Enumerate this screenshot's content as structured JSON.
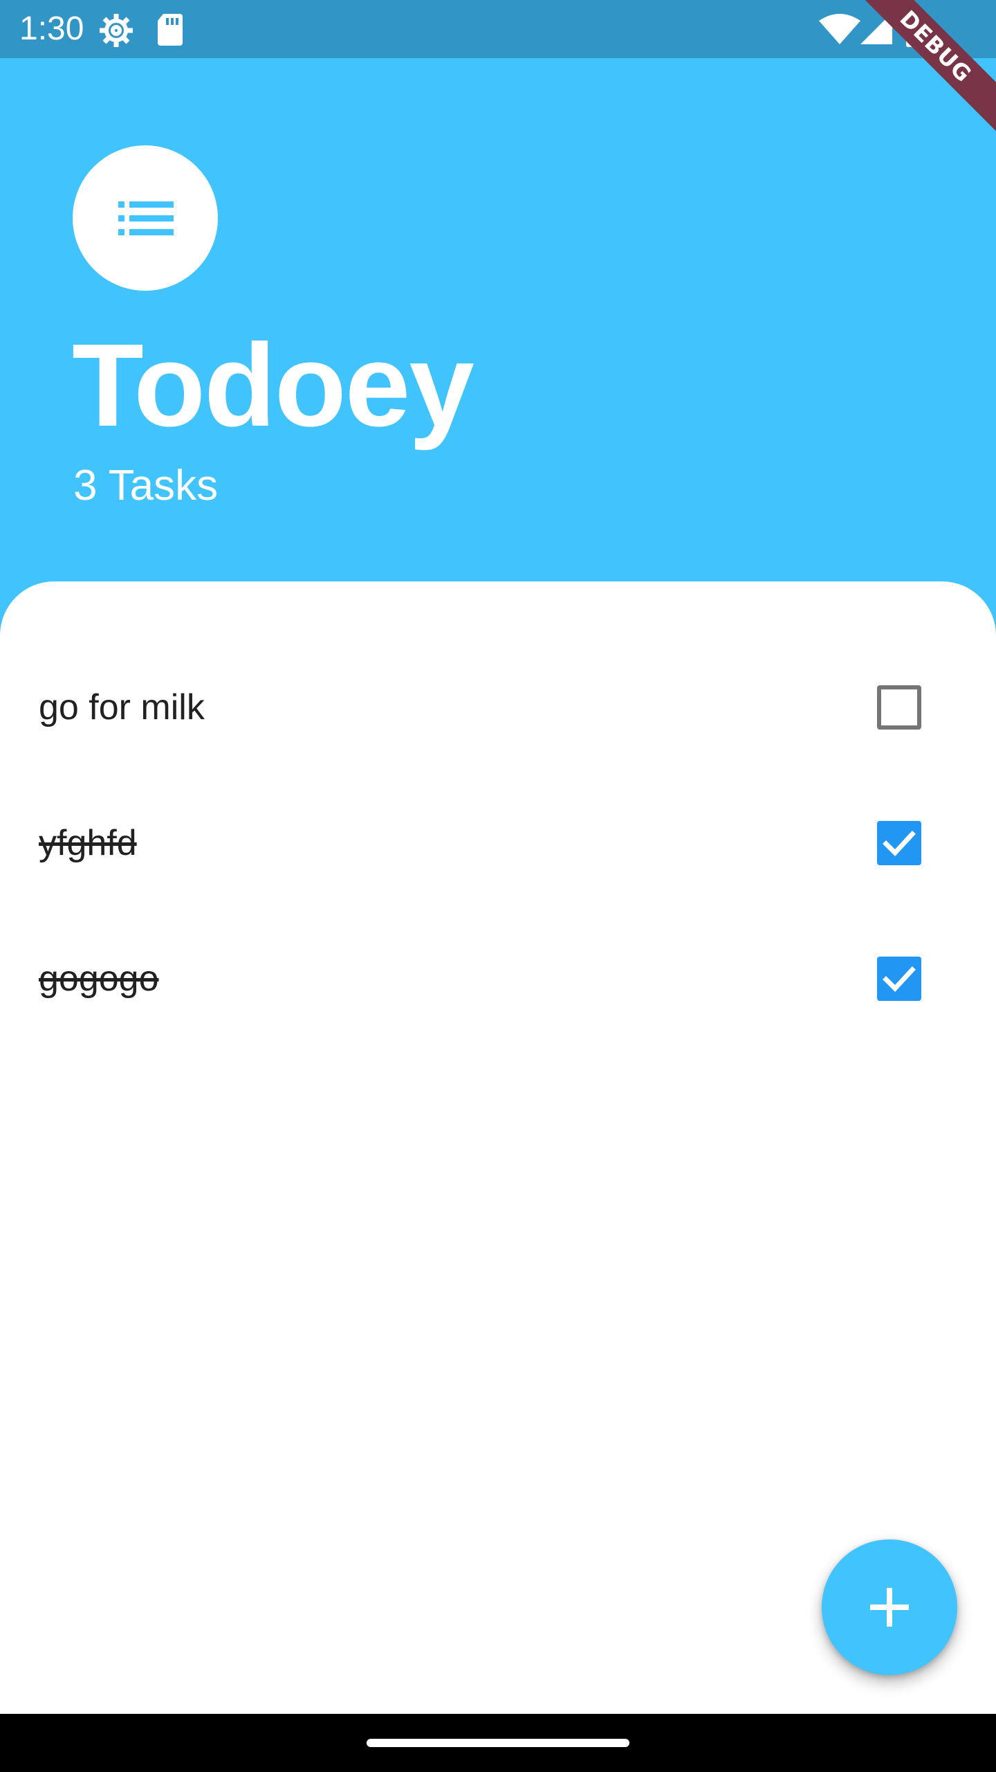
{
  "status_bar": {
    "time": "1:30",
    "icons": [
      "settings-gear-icon",
      "sd-card-icon",
      "wifi-icon",
      "signal-icon",
      "battery-icon"
    ],
    "color": "#3196c6"
  },
  "debug_banner": {
    "label": "DEBUG",
    "color": "#7a3447"
  },
  "header": {
    "icon": "list-icon",
    "title": "Todoey",
    "subtitle": "3 Tasks",
    "background": "#41c3fd"
  },
  "tasks": [
    {
      "label": "go for milk",
      "done": false
    },
    {
      "label": "yfghfd",
      "done": true
    },
    {
      "label": "gogogo",
      "done": true
    }
  ],
  "fab": {
    "icon": "plus-icon",
    "color": "#41c3fd"
  },
  "accent_color": "#2196f3"
}
